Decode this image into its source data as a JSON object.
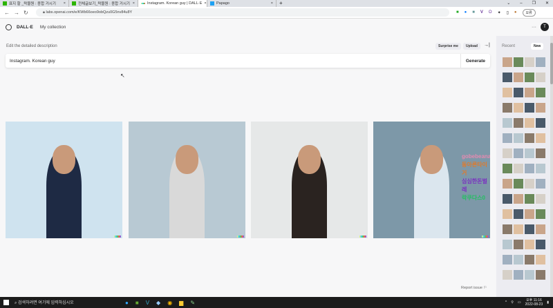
{
  "browser": {
    "tabs": [
      {
        "label": "표지 할 _락물원 : 종합 거시기"
      },
      {
        "label": "전체글보기_락물원 : 종합 거시기"
      },
      {
        "label": "Instagram. Korean guy | DALL·E",
        "active": true
      },
      {
        "label": "Papago"
      }
    ],
    "url": "labs.openai.com/e/KWb66oeo9obQzu0G5nv84u8Y",
    "profile": "오류"
  },
  "app": {
    "brand": "DALL·E",
    "nav_collection": "My collection",
    "avatar_initial": "T"
  },
  "editor": {
    "label": "Edit the detailed description",
    "surprise": "Surprise me",
    "upload": "Upload",
    "prompt": "Instagram. Korean guy",
    "generate": "Generate"
  },
  "images": [
    {
      "bg": "#cfe3ef",
      "shirt": "#1e2a44"
    },
    {
      "bg": "#b8c9d3",
      "shirt": "#d9d9d9"
    },
    {
      "bg": "#e6e8e8",
      "shirt": "#2a2320"
    },
    {
      "bg": "#7d98a8",
      "shirt": "#dbe6ee"
    }
  ],
  "overlay_text": [
    "gobebeana",
    "동아른타이거",
    "심심한돈벌레",
    "락쿠다스0"
  ],
  "report": "Report issue",
  "sidebar": {
    "recent": "Recent",
    "new": "New"
  },
  "taskbar": {
    "search": "검색하려면 여기에 입력하십시오",
    "time": "오후 11:16",
    "date": "2022-08-23"
  }
}
